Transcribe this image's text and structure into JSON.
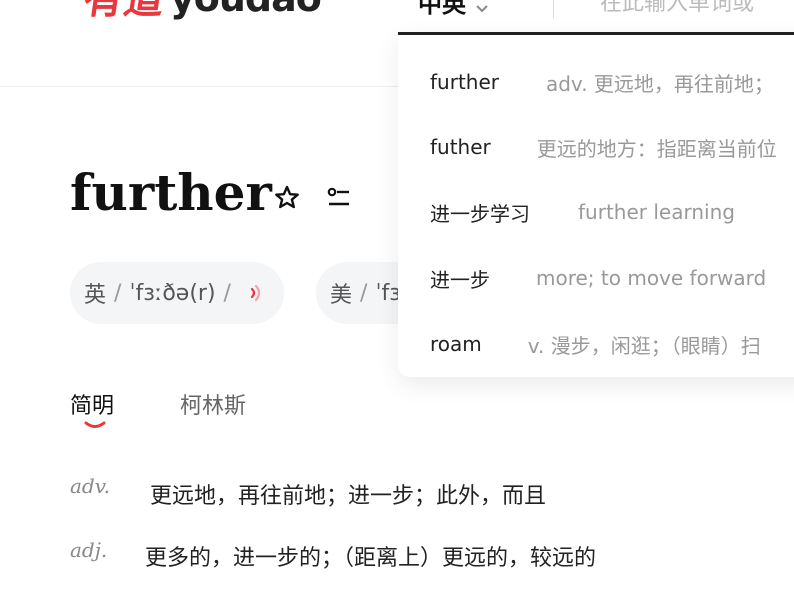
{
  "header": {
    "logo_cn": "有道",
    "logo_en": "youdao",
    "language": "中英",
    "search_placeholder": "在此输入单词或"
  },
  "suggestions": [
    {
      "word": "further",
      "desc": "adv. 更远地，再往前地；"
    },
    {
      "word": "futher",
      "desc": "更远的地方：指距离当前位"
    },
    {
      "word": "进一步学习",
      "desc": "further learning"
    },
    {
      "word": "进一步",
      "desc": "more; to move forward"
    },
    {
      "word": "roam",
      "desc": "v. 漫步，闲逛；（眼睛）扫"
    }
  ],
  "entry": {
    "word": "further",
    "pron_uk_label": "英",
    "pron_uk_ipa": "ˈfɜːðə(r)",
    "pron_us_label": "美",
    "pron_us_ipa": "ˈfɜːrðər",
    "sep": "/"
  },
  "tabs": [
    "简明",
    "柯林斯"
  ],
  "definitions": [
    {
      "pos": "adv.",
      "text": "更远地，再往前地；进一步；此外，而且"
    },
    {
      "pos": "adj.",
      "text": "更多的，进一步的；（距离上）更远的，较远的"
    }
  ],
  "colors": {
    "accent": "#e8373d",
    "text": "#111111",
    "muted": "#999999",
    "pill_bg": "#f4f5f7"
  },
  "icons": [
    "star-icon",
    "wordlist-icon",
    "speaker-icon",
    "chevron-down-icon"
  ]
}
